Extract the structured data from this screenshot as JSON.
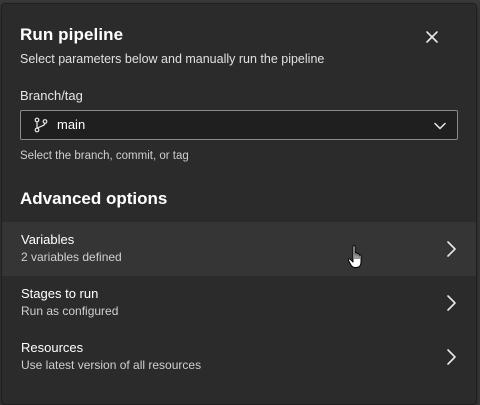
{
  "dialog": {
    "title": "Run pipeline",
    "subtitle": "Select parameters below and manually run the pipeline",
    "close_icon": "close-icon"
  },
  "branch": {
    "label": "Branch/tag",
    "value": "main",
    "icon": "git-branch-icon",
    "hint": "Select the branch, commit, or tag"
  },
  "advanced": {
    "title": "Advanced options",
    "items": [
      {
        "title": "Variables",
        "subtitle": "2 variables defined"
      },
      {
        "title": "Stages to run",
        "subtitle": "Run as configured"
      },
      {
        "title": "Resources",
        "subtitle": "Use latest version of all resources"
      }
    ]
  },
  "colors": {
    "panel_bg": "#2b2b2b",
    "hover_bg": "#353535",
    "input_bg": "#1f1f1f",
    "text": "#ffffff"
  }
}
